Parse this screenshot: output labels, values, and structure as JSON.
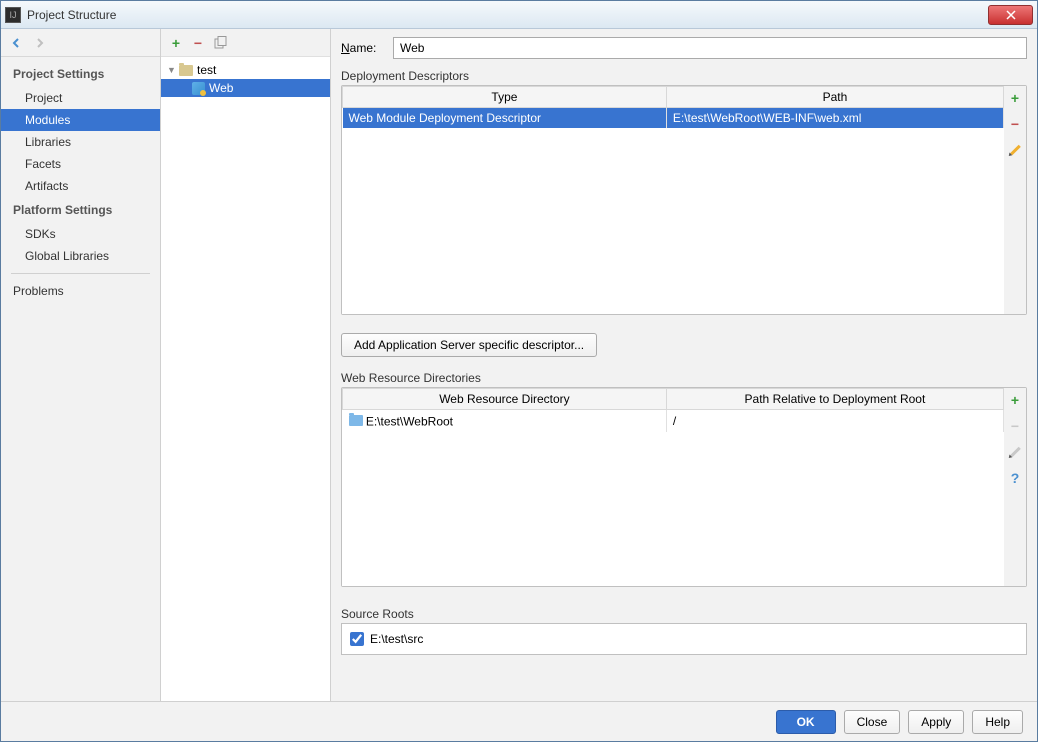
{
  "window": {
    "title": "Project Structure"
  },
  "sidebar": {
    "sections": [
      {
        "heading": "Project Settings",
        "items": [
          {
            "label": "Project",
            "selected": false
          },
          {
            "label": "Modules",
            "selected": true
          },
          {
            "label": "Libraries",
            "selected": false
          },
          {
            "label": "Facets",
            "selected": false
          },
          {
            "label": "Artifacts",
            "selected": false
          }
        ]
      },
      {
        "heading": "Platform Settings",
        "items": [
          {
            "label": "SDKs",
            "selected": false
          },
          {
            "label": "Global Libraries",
            "selected": false
          }
        ]
      }
    ],
    "extra": {
      "label": "Problems"
    }
  },
  "tree": {
    "root": {
      "label": "test"
    },
    "child": {
      "label": "Web",
      "selected": true
    }
  },
  "form": {
    "name_label": "Name:",
    "name_value": "Web"
  },
  "deployment": {
    "title": "Deployment Descriptors",
    "columns": {
      "type": "Type",
      "path": "Path"
    },
    "rows": [
      {
        "type": "Web Module Deployment Descriptor",
        "path": "E:\\test\\WebRoot\\WEB-INF\\web.xml",
        "selected": true
      }
    ],
    "add_button": "Add Application Server specific descriptor..."
  },
  "webres": {
    "title": "Web Resource Directories",
    "columns": {
      "dir": "Web Resource Directory",
      "rel": "Path Relative to Deployment Root"
    },
    "rows": [
      {
        "dir": "E:\\test\\WebRoot",
        "rel": "/"
      }
    ]
  },
  "source_roots": {
    "title": "Source Roots",
    "items": [
      {
        "label": "E:\\test\\src",
        "checked": true
      }
    ]
  },
  "footer": {
    "ok": "OK",
    "close": "Close",
    "apply": "Apply",
    "help": "Help"
  }
}
